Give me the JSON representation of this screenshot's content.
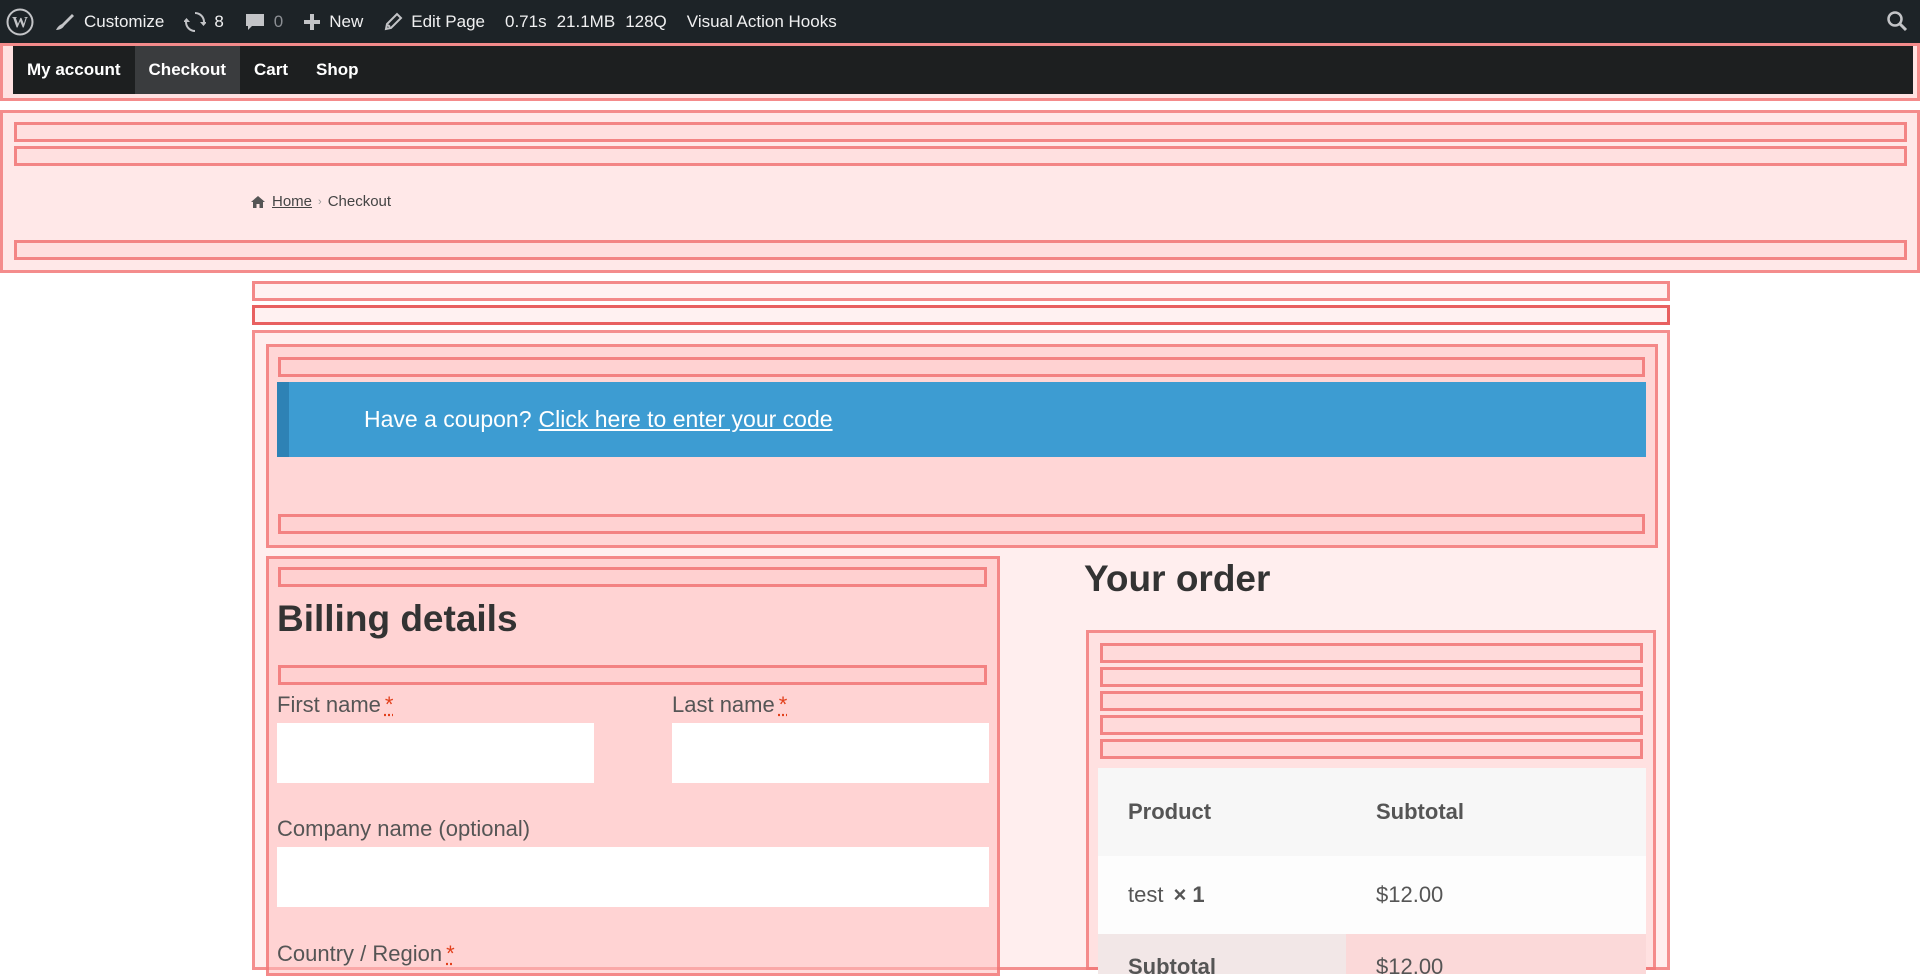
{
  "admin_bar": {
    "customize_label": "Customize",
    "updates_count": "8",
    "comments_count": "0",
    "new_label": "New",
    "edit_page_label": "Edit Page",
    "perf_time": "0.71s",
    "perf_memory": "21.1MB",
    "perf_queries": "128Q",
    "visual_hooks_label": "Visual Action Hooks"
  },
  "store_nav": {
    "items": [
      {
        "label": "My account"
      },
      {
        "label": "Checkout"
      },
      {
        "label": "Cart"
      },
      {
        "label": "Shop"
      }
    ]
  },
  "breadcrumb": {
    "home": "Home",
    "current": "Checkout"
  },
  "coupon": {
    "text": "Have a coupon?",
    "link": "Click here to enter your code"
  },
  "billing": {
    "title": "Billing details",
    "first_name_label": "First name",
    "last_name_label": "Last name",
    "company_label": "Company name (optional)",
    "country_label": "Country / Region",
    "required_mark": "*"
  },
  "order": {
    "title": "Your order",
    "col_product": "Product",
    "col_subtotal": "Subtotal",
    "item_name": "test",
    "item_qty": "× 1",
    "item_price": "$12.00",
    "subtotal_label": "Subtotal",
    "subtotal_value": "$12.00"
  },
  "colors": {
    "admin_bar_bg": "#1d2327",
    "coupon_bg": "#3d9cd2",
    "hook_outline": "#f06e6e",
    "required": "#e2401c"
  }
}
